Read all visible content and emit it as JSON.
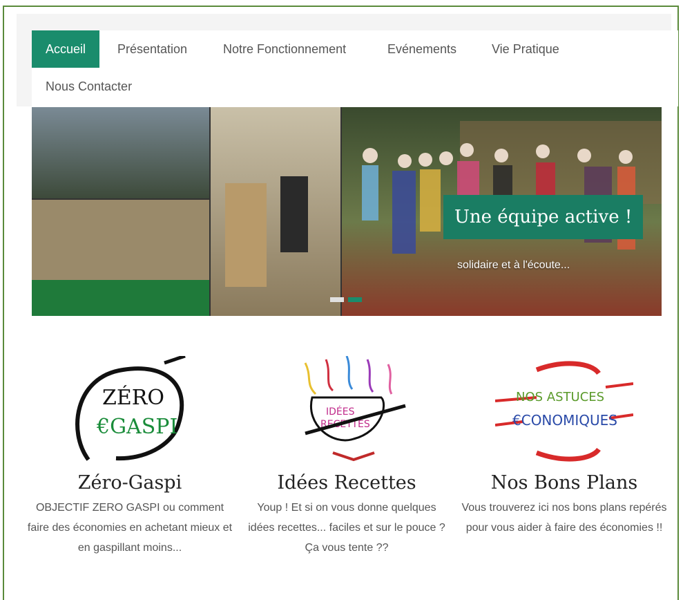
{
  "nav": {
    "items": [
      {
        "label": "Accueil",
        "active": true
      },
      {
        "label": "Présentation",
        "active": false
      },
      {
        "label": "Notre Fonctionnement",
        "active": false
      },
      {
        "label": "Evénements",
        "active": false
      },
      {
        "label": "Vie Pratique",
        "active": false
      },
      {
        "label": "Nous Contacter",
        "active": false
      }
    ]
  },
  "slider": {
    "caption_title": "Une équipe active !",
    "caption_subtitle": "solidaire et à l'écoute...",
    "slide_count": 2,
    "current_slide": 2
  },
  "features": [
    {
      "title": "Zéro-Gaspi",
      "logo_text": [
        "ZÉRO",
        "€GASPI"
      ],
      "icon": "zero-gaspi-logo",
      "description": "OBJECTIF ZERO GASPI ou comment faire des économies en achetant mieux et en gaspillant moins..."
    },
    {
      "title": "Idées Recettes",
      "logo_text": [
        "IDÉES",
        "RECETTES"
      ],
      "icon": "idees-recettes-logo",
      "description": "Youp ! Et si on vous donne quelques idées recettes... faciles et sur le pouce ? Ça vous tente ??"
    },
    {
      "title": "Nos Bons Plans",
      "logo_text": [
        "NOS ASTUCES",
        "€CONOMIQUES"
      ],
      "icon": "astuces-economiques-logo",
      "description": "Vous trouverez ici nos bons plans repérés pour vous aider à faire des économies !!"
    }
  ],
  "colors": {
    "accent": "#1a8c6c",
    "caption_bg": "#1a7d63",
    "window_border": "#5a8a3a"
  }
}
